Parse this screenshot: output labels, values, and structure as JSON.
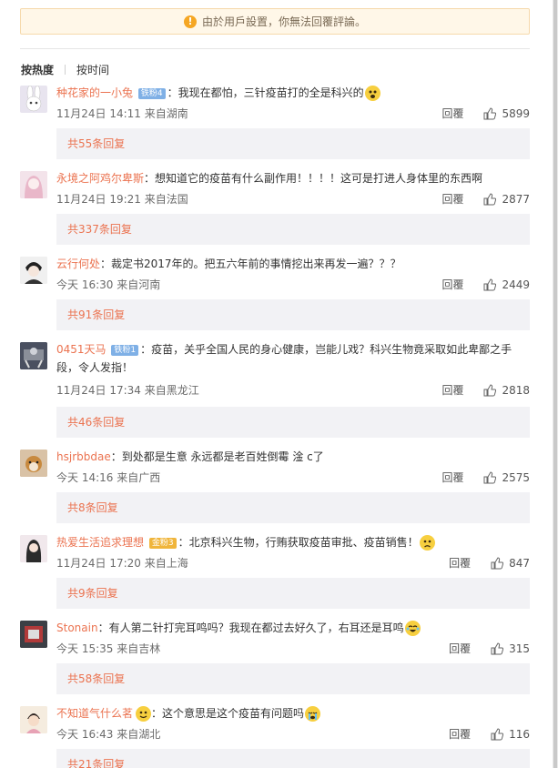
{
  "notice": {
    "text": "由於用戶設置，你無法回覆評論。",
    "icon": "warning-icon"
  },
  "sort": {
    "active": "按热度",
    "inactive": "按时间"
  },
  "colors": {
    "username": "#eb7350",
    "accent": "#f5a623"
  },
  "comments": [
    {
      "user": "种花家的一小兔",
      "badge": "铁粉4",
      "badge_type": "blue-heart",
      "text": "：我现在都怕，三针疫苗打的全是科兴的",
      "emoji": "fear-face",
      "time": "11月24日 14:11",
      "source": "来自湖南",
      "reply": "回覆",
      "likes": "5899",
      "replies": "共55条回复"
    },
    {
      "user": "永境之阿鸡尔卑斯",
      "badge": "",
      "text": "：想知道它的疫苗有什么副作用！！！！这可是打进人身体里的东西啊",
      "emoji": "",
      "time": "11月24日 19:21",
      "source": "来自法国",
      "reply": "回覆",
      "likes": "2877",
      "replies": "共337条回复"
    },
    {
      "user": "云行何处",
      "badge": "",
      "text": "：裁定书2017年的。把五六年前的事情挖出来再发一遍？？？",
      "emoji": "",
      "time": "今天 16:30",
      "source": "来自河南",
      "reply": "回覆",
      "likes": "2449",
      "replies": "共91条回复"
    },
    {
      "user": "0451天马",
      "badge": "铁粉1",
      "text": "：疫苗，关乎全国人民的身心健康，岂能儿戏？科兴生物竟采取如此卑鄙之手段，令人发指！",
      "emoji": "",
      "time": "11月24日 17:34",
      "source": "来自黑龙江",
      "reply": "回覆",
      "likes": "2818",
      "replies": "共46条回复"
    },
    {
      "user": "hsjrbbdae",
      "badge": "",
      "text": "：到处都是生意 永远都是老百姓倒霉 淦 c了",
      "emoji": "",
      "time": "今天 14:16",
      "source": "来自广西",
      "reply": "回覆",
      "likes": "2575",
      "replies": "共8条回复"
    },
    {
      "user": "热爱生活追求理想",
      "badge": "金粉3",
      "badge_type": "gold",
      "text": "：北京科兴生物，行贿获取疫苗审批、疫苗销售！",
      "emoji": "sad-face",
      "time": "11月24日 17:20",
      "source": "来自上海",
      "reply": "回覆",
      "likes": "847",
      "replies": "共9条回复"
    },
    {
      "user": "Stonain",
      "badge": "",
      "text": "：有人第二针打完耳鸣吗？我现在都过去好久了，右耳还是耳鸣",
      "emoji": "crying-laugh-face",
      "time": "今天 15:35",
      "source": "来自吉林",
      "reply": "回覆",
      "likes": "315",
      "replies": "共58条回复"
    },
    {
      "user": "不知道气什么茗",
      "badge": "",
      "text": "：这个意思是这个疫苗有问题吗",
      "emoji": "crying-face",
      "time": "今天 16:43",
      "source": "来自湖北",
      "reply": "回覆",
      "likes": "116",
      "replies": "共21条回复"
    }
  ]
}
